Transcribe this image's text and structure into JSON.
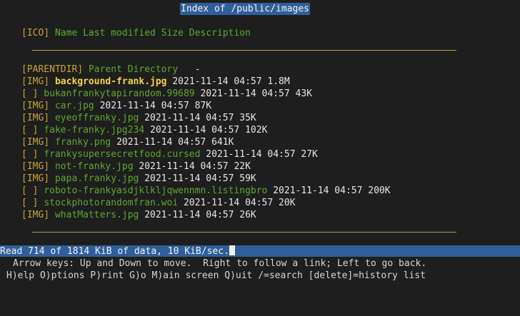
{
  "page": {
    "title": "Index of /public/images"
  },
  "columns_header": {
    "ico": "[ICO]",
    "rest": " Name Last modified Size Description"
  },
  "parent_dir": {
    "tag": "[PARENTDIR]",
    "label": "Parent Directory",
    "meta": "   -"
  },
  "entries": [
    {
      "tag": "[IMG]",
      "name": "background-frank.jpg",
      "modified": "2021-11-14 04:57",
      "size": "1.8M",
      "selected": true
    },
    {
      "tag": "[ ]",
      "name": "bukanfrankytapirandom.99689",
      "modified": "2021-11-14 04:57",
      "size": "43K",
      "selected": false
    },
    {
      "tag": "[IMG]",
      "name": "car.jpg",
      "modified": "2021-11-14 04:57",
      "size": "87K",
      "selected": false
    },
    {
      "tag": "[IMG]",
      "name": "eyeoffranky.jpg",
      "modified": "2021-11-14 04:57",
      "size": "35K",
      "selected": false
    },
    {
      "tag": "[ ]",
      "name": "fake-franky.jpg234",
      "modified": "2021-11-14 04:57",
      "size": "102K",
      "selected": false
    },
    {
      "tag": "[IMG]",
      "name": "franky.png",
      "modified": "2021-11-14 04:57",
      "size": "641K",
      "selected": false
    },
    {
      "tag": "[ ]",
      "name": "frankysupersecretfood.cursed",
      "modified": "2021-11-14 04:57",
      "size": "27K",
      "selected": false
    },
    {
      "tag": "[IMG]",
      "name": "not-franky.jpg",
      "modified": "2021-11-14 04:57",
      "size": "22K",
      "selected": false
    },
    {
      "tag": "[IMG]",
      "name": "papa.franky.jpg",
      "modified": "2021-11-14 04:57",
      "size": "59K",
      "selected": false
    },
    {
      "tag": "[ ]",
      "name": "roboto-frankyasdjklkljqwennmn.listingbro",
      "modified": "2021-11-14 04:57",
      "size": "200K",
      "selected": false
    },
    {
      "tag": "[ ]",
      "name": "stockphotorandomfran.woi",
      "modified": "2021-11-14 04:57",
      "size": "20K",
      "selected": false
    },
    {
      "tag": "[IMG]",
      "name": "whatMatters.jpg",
      "modified": "2021-11-14 04:57",
      "size": "26K",
      "selected": false
    }
  ],
  "status": {
    "text": "Read 714 of 1814 KiB of data, 10 KiB/sec."
  },
  "help": {
    "line1": "Arrow keys: Up and Down to move.  Right to follow a link; Left to go back.",
    "line2": "H)elp O)ptions P)rint G)o M)ain screen Q)uit /=search [delete]=history list"
  },
  "colors": {
    "background": "#1e1e1e",
    "title_bar": "#2f5f9a",
    "tag": "#c8a23a",
    "link": "#5fa82e",
    "selected_link": "#f2d447",
    "rule": "#b8a24a"
  }
}
